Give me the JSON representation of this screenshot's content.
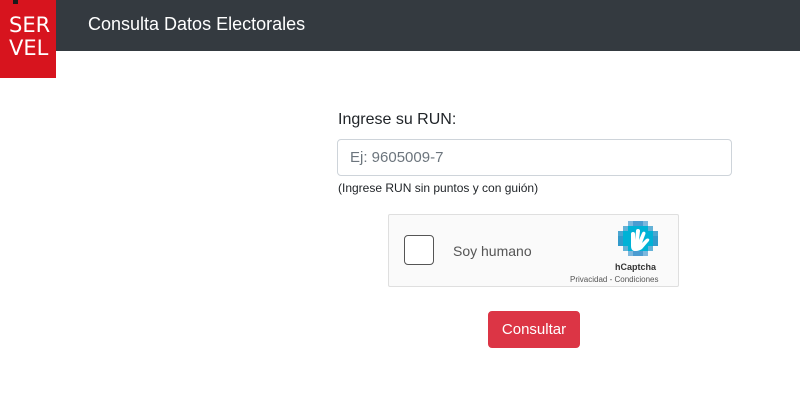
{
  "header": {
    "logo_line1": "SER",
    "logo_line2": "VEL",
    "title": "Consulta Datos Electorales",
    "bg_color": "#343a40",
    "logo_color": "#d7141e"
  },
  "form": {
    "run_label": "Ingrese su RUN:",
    "run_placeholder": "Ej: 9605009-7",
    "run_value": "",
    "run_hint": "(Ingrese RUN sin puntos y con guión)",
    "submit_label": "Consultar",
    "submit_color": "#dc3545"
  },
  "captcha": {
    "checkbox_label": "Soy humano",
    "brand": "hCaptcha",
    "privacy_label": "Privacidad",
    "separator": " - ",
    "terms_label": "Condiciones",
    "logo_icon": "hcaptcha-hand-icon",
    "checked": false
  }
}
